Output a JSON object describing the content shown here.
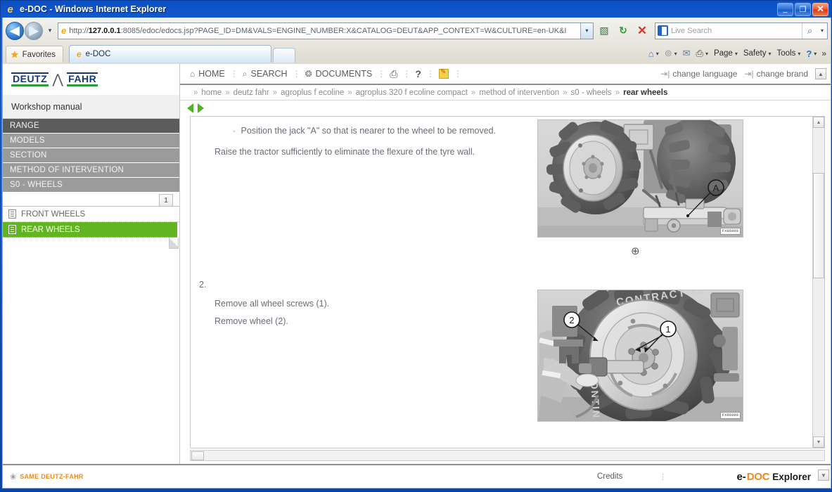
{
  "window": {
    "title": "e-DOC - Windows Internet Explorer",
    "minimize_label": "_",
    "maximize_label": "❐",
    "close_label": "✕"
  },
  "browser": {
    "back_label": "◀",
    "forward_label": "▶",
    "history_dropdown_label": "▾",
    "url": "http://127.0.0.1:8085/edoc/edocs.jsp?PAGE_ID=DM&VALS=ENGINE_NUMBER:X&CATALOG=DEUT&APP_CONTEXT=W&CULTURE=en-UK&I",
    "url_host": "127.0.0.1",
    "url_scheme": "http://",
    "url_rest": ":8085/edoc/edocs.jsp?PAGE_ID=DM&VALS=ENGINE_NUMBER:X&CATALOG=DEUT&APP_CONTEXT=W&CULTURE=en-UK&I",
    "url_dropdown_label": "▾",
    "compat_label": "▧",
    "refresh_label": "↻",
    "stop_label": "✕",
    "search_placeholder": "Live Search",
    "search_go_label": "⌕",
    "search_dropdown_label": "▾",
    "favorites_label": "Favorites",
    "favorites_icon": "★",
    "tab_label": "e-DOC",
    "new_tab_label": "",
    "commands": [
      {
        "label": "",
        "icon": "home-icon",
        "glyph": "⌂",
        "caret": "▾"
      },
      {
        "label": "",
        "icon": "feeds-icon",
        "glyph": "⊚",
        "caret": "▾"
      },
      {
        "label": "",
        "icon": "mail-icon",
        "glyph": "✉",
        "caret": ""
      },
      {
        "label": "",
        "icon": "print-icon",
        "glyph": "⎙",
        "caret": "▾"
      },
      {
        "label": "Page",
        "icon": "page-menu",
        "glyph": "",
        "caret": "▾"
      },
      {
        "label": "Safety",
        "icon": "safety-menu",
        "glyph": "",
        "caret": "▾"
      },
      {
        "label": "Tools",
        "icon": "tools-menu",
        "glyph": "",
        "caret": "▾"
      },
      {
        "label": "",
        "icon": "help-icon",
        "glyph": "?",
        "caret": "▾"
      }
    ],
    "overflow_label": "»"
  },
  "sidebar": {
    "brand_left": "DEUTZ",
    "brand_right": "FAHR",
    "brand_mark": "⋀",
    "manual_title": "Workshop manual",
    "nav_items": [
      {
        "label": "RANGE",
        "selected": true
      },
      {
        "label": "MODELS",
        "selected": false
      },
      {
        "label": "SECTION",
        "selected": false
      },
      {
        "label": "METHOD OF INTERVENTION",
        "selected": false
      },
      {
        "label": "S0 - WHEELS",
        "selected": false
      }
    ],
    "tree_tab_label": "1",
    "tree_items": [
      {
        "label": "FRONT WHEELS",
        "active": false
      },
      {
        "label": "REAR WHEELS",
        "active": true
      }
    ]
  },
  "topnav": {
    "links": [
      {
        "label": "HOME",
        "icon": "home-icon",
        "glyph": "⌂"
      },
      {
        "label": "SEARCH",
        "icon": "search-icon",
        "glyph": "⌕"
      },
      {
        "label": "DOCUMENTS",
        "icon": "documents-icon",
        "glyph": "❂"
      }
    ],
    "tools": [
      {
        "label": "",
        "icon": "print-icon",
        "glyph": "⎙"
      },
      {
        "label": "",
        "icon": "help-icon",
        "glyph": "?"
      },
      {
        "label": "",
        "icon": "notes-icon",
        "glyph": ""
      }
    ],
    "change_language": "change language",
    "change_brand": "change brand",
    "arrow_glyph": "⇥|",
    "scroll_up_label": "▲",
    "scroll_down_label": "▼"
  },
  "breadcrumb": {
    "separator": "»",
    "items": [
      {
        "label": "home",
        "current": false
      },
      {
        "label": "deutz fahr",
        "current": false
      },
      {
        "label": "agroplus f ecoline",
        "current": false
      },
      {
        "label": "agroplus 320 f ecoline compact",
        "current": false
      },
      {
        "label": "method of intervention",
        "current": false
      },
      {
        "label": "s0 - wheels",
        "current": false
      },
      {
        "label": "rear wheels",
        "current": true
      }
    ]
  },
  "page_nav": {
    "prev_label": "◀",
    "next_label": "▶"
  },
  "document": {
    "blocks": [
      {
        "type": "bullet",
        "bullet": "◦",
        "text": "Position the jack \"A\" so that is nearer to the wheel to be removed."
      },
      {
        "type": "para",
        "text": "Raise the tractor sufficiently to eliminate the flexure of the tyre wall."
      },
      {
        "type": "step",
        "text": "2."
      },
      {
        "type": "para",
        "text": "Remove all wheel screws (1)."
      },
      {
        "type": "para",
        "text": "Remove wheel (2)."
      }
    ],
    "figures": [
      {
        "name": "figure-jack-position",
        "alt": "Tractor rear wheel raised by a trolley jack, callout A points to the jack",
        "code": "FX06000",
        "callouts": [
          "A"
        ],
        "zoom_icon": "zoom-in-icon"
      },
      {
        "name": "figure-wheel-removal",
        "alt": "Mechanic removing the rear wheel screws, callouts 1 and 2",
        "code": "FX06000",
        "callouts": [
          "1",
          "2"
        ],
        "zoom_icon": ""
      }
    ],
    "scrollbar": {
      "up_label": "▲",
      "down_label": "▼",
      "h_left_label": "",
      "h_right_label": ""
    }
  },
  "footer": {
    "company": "SAME DEUTZ-FAHR",
    "company_mark": "❀",
    "credits": "Credits",
    "credits_separator": "⋮",
    "product_e": "e-",
    "product_doc": "DOC",
    "product_suffix": "Explorer",
    "scroll_down_label": "▼"
  },
  "colors": {
    "accent_green": "#62b521",
    "brand_orange": "#f08a1e",
    "brand_blue": "#14387a",
    "nav_gray": "#9b9b9b",
    "nav_gray_selected": "#5c5c5c"
  }
}
